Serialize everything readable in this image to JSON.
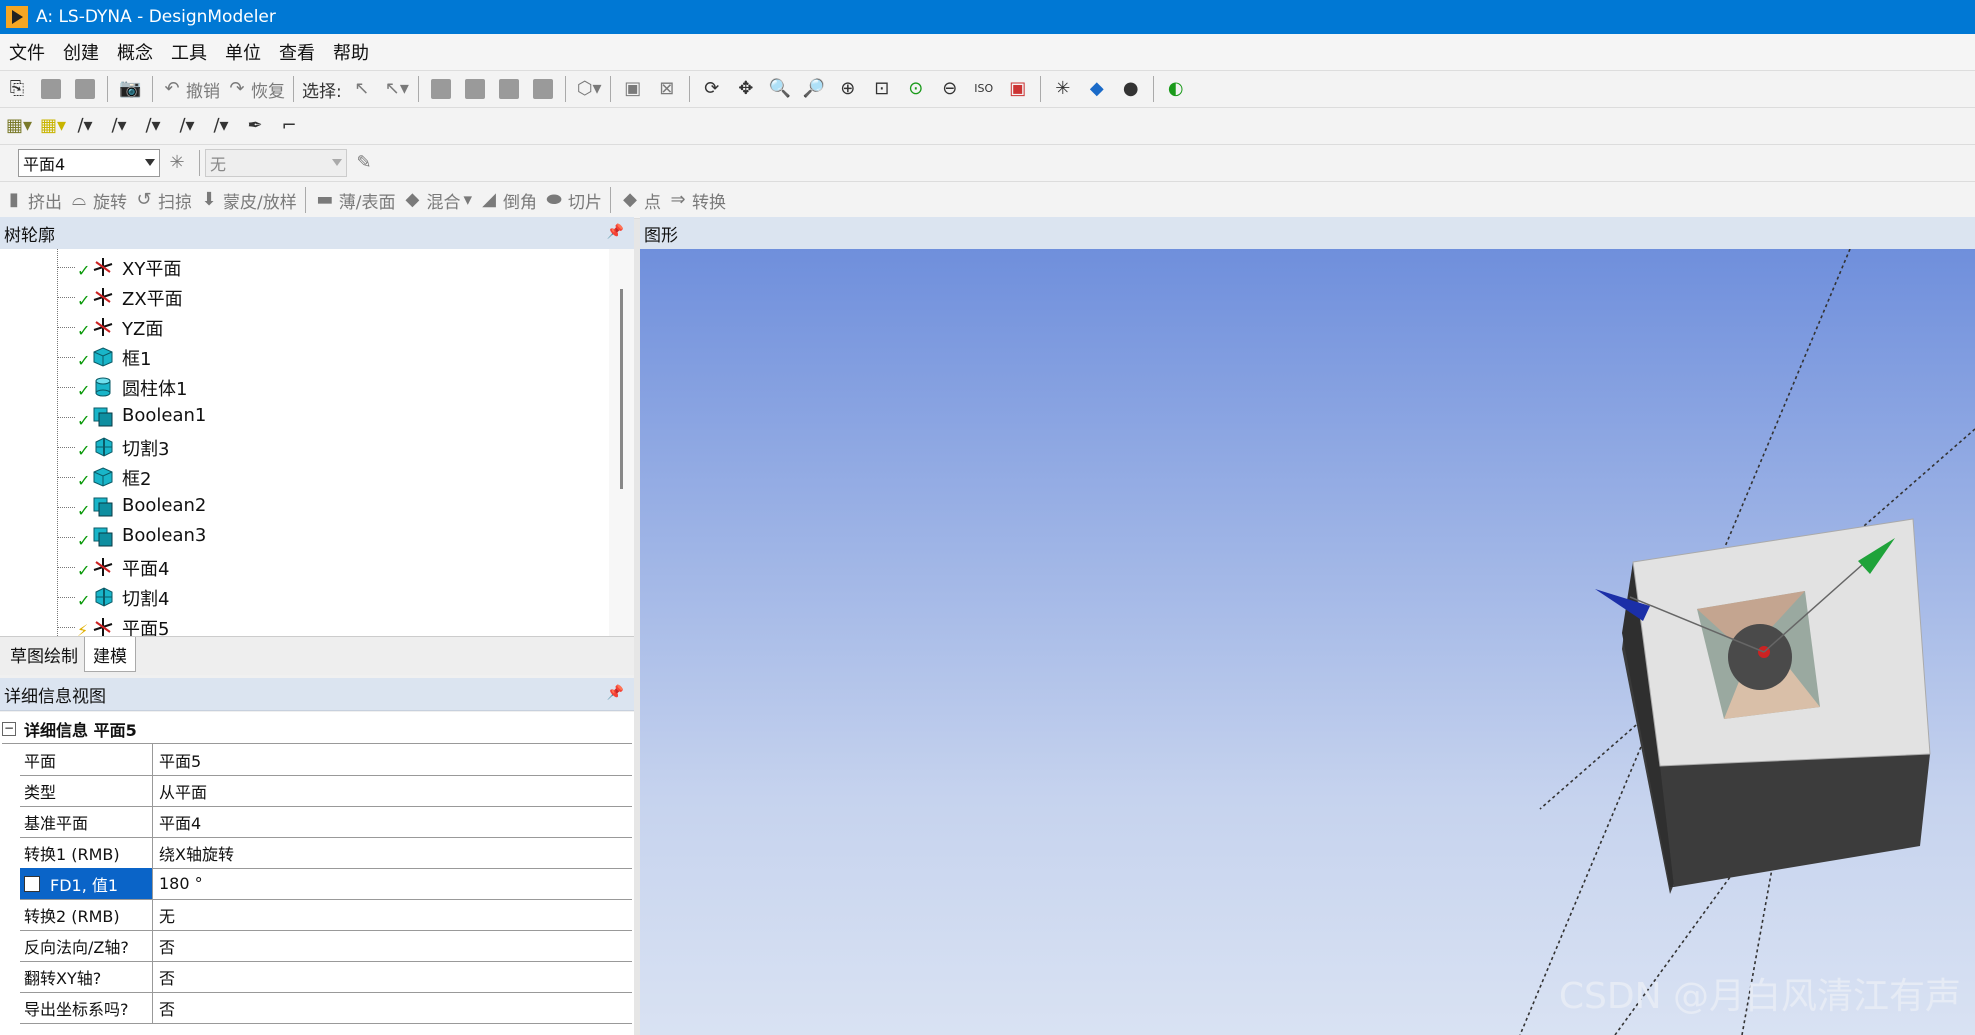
{
  "window": {
    "title": "A: LS-DYNA - DesignModeler"
  },
  "menu": [
    "文件",
    "创建",
    "概念",
    "工具",
    "单位",
    "查看",
    "帮助"
  ],
  "toolbar1": {
    "undo": "撤销",
    "redo": "恢复",
    "select": "选择:"
  },
  "toolbar3": {
    "plane_select": "平面4",
    "sketch_select": "无"
  },
  "toolbar4": {
    "extrude": "挤出",
    "revolve": "旋转",
    "sweep": "扫掠",
    "skin": "蒙皮/放样",
    "thin": "薄/表面",
    "blend": "混合",
    "chamfer": "倒角",
    "slice": "切片",
    "point": "点",
    "convert": "转换"
  },
  "tree": {
    "title": "树轮廓",
    "items": [
      {
        "label": "XY平面",
        "icon": "plane-icon",
        "status": "ok"
      },
      {
        "label": "ZX平面",
        "icon": "plane-icon",
        "status": "ok"
      },
      {
        "label": "YZ面",
        "icon": "plane-icon",
        "status": "ok"
      },
      {
        "label": "框1",
        "icon": "box-icon",
        "status": "ok"
      },
      {
        "label": "圆柱体1",
        "icon": "cylinder-icon",
        "status": "ok"
      },
      {
        "label": "Boolean1",
        "icon": "boolean-icon",
        "status": "ok"
      },
      {
        "label": "切割3",
        "icon": "slice-icon",
        "status": "ok"
      },
      {
        "label": "框2",
        "icon": "box-icon",
        "status": "ok"
      },
      {
        "label": "Boolean2",
        "icon": "boolean-icon",
        "status": "ok"
      },
      {
        "label": "Boolean3",
        "icon": "boolean-icon",
        "status": "ok"
      },
      {
        "label": "平面4",
        "icon": "plane-icon",
        "status": "ok"
      },
      {
        "label": "切割4",
        "icon": "slice-icon",
        "status": "ok"
      },
      {
        "label": "平面5",
        "icon": "plane-icon",
        "status": "warn"
      }
    ]
  },
  "tabs": {
    "sketch": "草图绘制",
    "model": "建模"
  },
  "graphics": {
    "title": "图形",
    "watermark": "CSDN @月白风清江有声"
  },
  "details": {
    "title": "详细信息视图",
    "header": "详细信息 平面5",
    "rows": [
      {
        "k": "平面",
        "v": "平面5"
      },
      {
        "k": "类型",
        "v": "从平面"
      },
      {
        "k": "基准平面",
        "v": "平面4"
      },
      {
        "k": "转换1 (RMB)",
        "v": "绕X轴旋转"
      },
      {
        "k": "FD1, 值1",
        "v": "180 °"
      },
      {
        "k": "转换2 (RMB)",
        "v": "无"
      },
      {
        "k": "反向法向/Z轴?",
        "v": "否"
      },
      {
        "k": "翻转XY轴?",
        "v": "否"
      },
      {
        "k": "导出坐标系吗?",
        "v": "否"
      }
    ]
  },
  "colors": {
    "titlebar": "#0078d4",
    "selection": "#0a64c8",
    "panel_header": "#dbe4f0"
  }
}
